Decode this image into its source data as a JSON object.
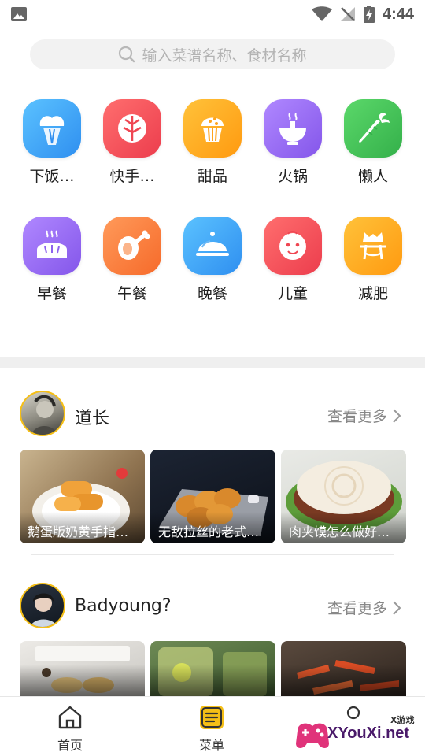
{
  "status_bar": {
    "time": "4:44"
  },
  "search": {
    "placeholder": "输入菜谱名称、食材名称"
  },
  "categories": [
    {
      "label": "下饭…",
      "icon": "rice-bowl-icon",
      "color": "#36a3f7"
    },
    {
      "label": "快手…",
      "icon": "leaf-icon",
      "color": "#f2505b"
    },
    {
      "label": "甜品",
      "icon": "cupcake-icon",
      "color": "#ffa41b"
    },
    {
      "label": "火锅",
      "icon": "hotpot-icon",
      "color": "#9b6cf0"
    },
    {
      "label": "懒人",
      "icon": "carrot-icon",
      "color": "#4cc25e"
    },
    {
      "label": "早餐",
      "icon": "bread-icon",
      "color": "#9b6cf0"
    },
    {
      "label": "午餐",
      "icon": "drumstick-icon",
      "color": "#fd7d3b"
    },
    {
      "label": "晚餐",
      "icon": "cloche-icon",
      "color": "#36a3f7"
    },
    {
      "label": "儿童",
      "icon": "baby-face-icon",
      "color": "#f2505b"
    },
    {
      "label": "减肥",
      "icon": "diet-icon",
      "color": "#ffa41b"
    }
  ],
  "sections": [
    {
      "user": "道长",
      "more": "查看更多",
      "recipes": [
        {
          "title": "鹅蛋版奶黄手指…"
        },
        {
          "title": "无敌拉丝的老式…"
        },
        {
          "title": "肉夹馍怎么做好…"
        }
      ]
    },
    {
      "user": "Badyoung?",
      "more": "查看更多",
      "recipes": [
        {
          "title": ""
        },
        {
          "title": ""
        },
        {
          "title": ""
        }
      ]
    }
  ],
  "nav": {
    "tabs": [
      {
        "label": "首页",
        "icon": "home-icon"
      },
      {
        "label": "菜单",
        "icon": "menu-list-icon"
      },
      {
        "label": "",
        "icon": "profile-icon"
      }
    ]
  },
  "watermark": {
    "brand": "XYouXi.net",
    "tag": "X游戏"
  },
  "accent_color": "#f5bf16"
}
